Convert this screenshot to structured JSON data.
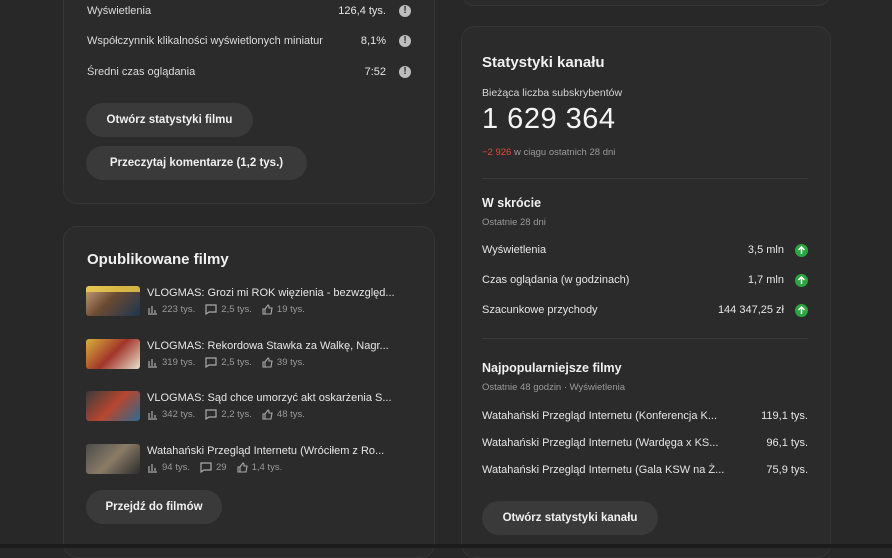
{
  "video_stats": {
    "rows": [
      {
        "label": "Wyświetlenia",
        "value": "126,4 tys."
      },
      {
        "label": "Współczynnik klikalności wyświetlonych miniatur",
        "value": "8,1%"
      },
      {
        "label": "Średni czas oglądania",
        "value": "7:52"
      }
    ],
    "open_stats_button": "Otwórz statystyki filmu",
    "read_comments_button": "Przeczytaj komentarze (1,2 tys.)"
  },
  "published": {
    "title": "Opublikowane filmy",
    "videos": [
      {
        "title": "VLOGMAS: Grozi mi ROK więzienia - bezwzględ...",
        "views": "223 tys.",
        "comments": "2,5 tys.",
        "likes": "19 tys."
      },
      {
        "title": "VLOGMAS: Rekordowa Stawka za Walkę, Nagr...",
        "views": "319 tys.",
        "comments": "2,5 tys.",
        "likes": "39 tys."
      },
      {
        "title": "VLOGMAS: Sąd chce umorzyć akt oskarżenia S...",
        "views": "342 tys.",
        "comments": "2,2 tys.",
        "likes": "48 tys."
      },
      {
        "title": "Watahański Przegląd Internetu (Wróciłem z Ro...",
        "views": "94 tys.",
        "comments": "29",
        "likes": "1,4 tys."
      }
    ],
    "go_to_videos_button": "Przejdź do filmów"
  },
  "channel": {
    "title": "Statystyki kanału",
    "subs_label": "Bieżąca liczba subskrybentów",
    "subs_count": "1 629 364",
    "subs_change": "−2 926",
    "subs_change_suffix": "w ciągu ostatnich 28 dni",
    "summary_title": "W skrócie",
    "summary_sub": "Ostatnie 28 dni",
    "summary": [
      {
        "label": "Wyświetlenia",
        "value": "3,5 mln"
      },
      {
        "label": "Czas oglądania (w godzinach)",
        "value": "1,7 mln"
      },
      {
        "label": "Szacunkowe przychody",
        "value": "144 347,25 zł"
      }
    ],
    "top_title": "Najpopularniejsze filmy",
    "top_sub": "Ostatnie 48 godzin · Wyświetlenia",
    "top": [
      {
        "title": "Watahański Przegląd Internetu (Konferencja K...",
        "value": "119,1 tys."
      },
      {
        "title": "Watahański Przegląd Internetu (Wardęga x KS...",
        "value": "96,1 tys."
      },
      {
        "title": "Watahański Przegląd Internetu (Gala KSW na Ż...",
        "value": "75,9 tys."
      }
    ],
    "open_channel_stats_button": "Otwórz statystyki kanału"
  },
  "colors": {
    "negative": "#e04a3f",
    "positive": "#2ba640"
  }
}
